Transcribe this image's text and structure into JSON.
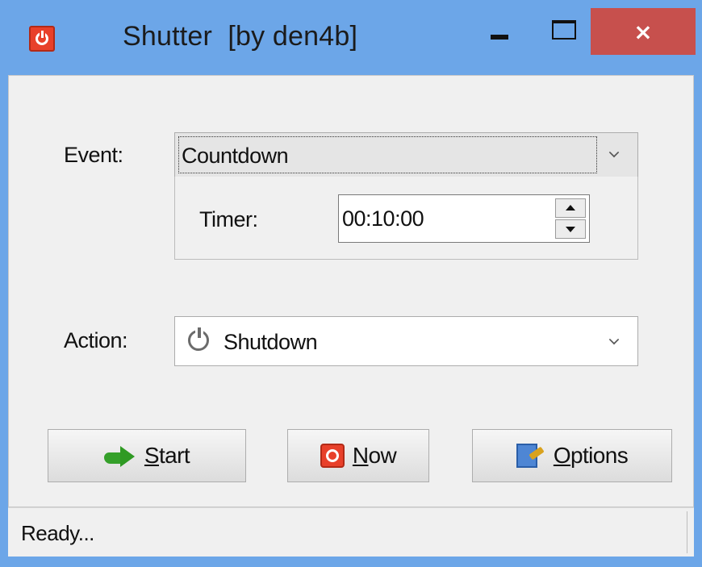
{
  "window": {
    "title": "Shutter  [by den4b]",
    "controls": {
      "minimize": "minimize-icon",
      "maximize": "maximize-icon",
      "close": "×"
    }
  },
  "event": {
    "label": "Event:",
    "value": "Countdown",
    "timer": {
      "label": "Timer:",
      "value": "00:10:00"
    }
  },
  "action": {
    "label": "Action:",
    "value": "Shutdown",
    "icon": "power-icon"
  },
  "buttons": {
    "start": {
      "accel": "S",
      "rest": "tart",
      "icon": "green-arrow-icon"
    },
    "now": {
      "accel": "N",
      "rest": "ow",
      "icon": "power-button-icon"
    },
    "options": {
      "accel": "O",
      "rest": "ptions",
      "icon": "options-icon"
    }
  },
  "status": {
    "text": "Ready..."
  },
  "colors": {
    "titlebar": "#6ca6e8",
    "close_button": "#c7504d",
    "client_bg": "#f0f0f0",
    "app_icon": "#e8402a"
  }
}
